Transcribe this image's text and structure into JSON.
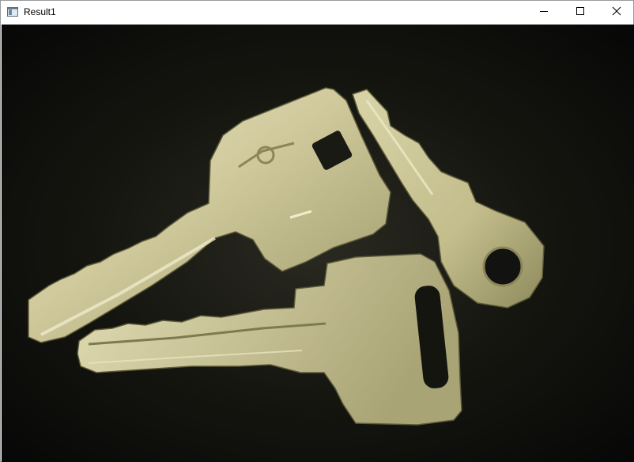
{
  "window": {
    "title": "Result1",
    "app_icon": "window-app-icon",
    "controls": {
      "minimize_icon": "minimize-icon",
      "maximize_icon": "maximize-icon",
      "close_icon": "close-icon"
    }
  },
  "image": {
    "subject": "three-keys-photo"
  },
  "colors": {
    "background": "#0e0e0c",
    "key_gold": "#c9c49a",
    "key_highlight": "#ece8c4",
    "key_shadow": "#7d7a52"
  }
}
